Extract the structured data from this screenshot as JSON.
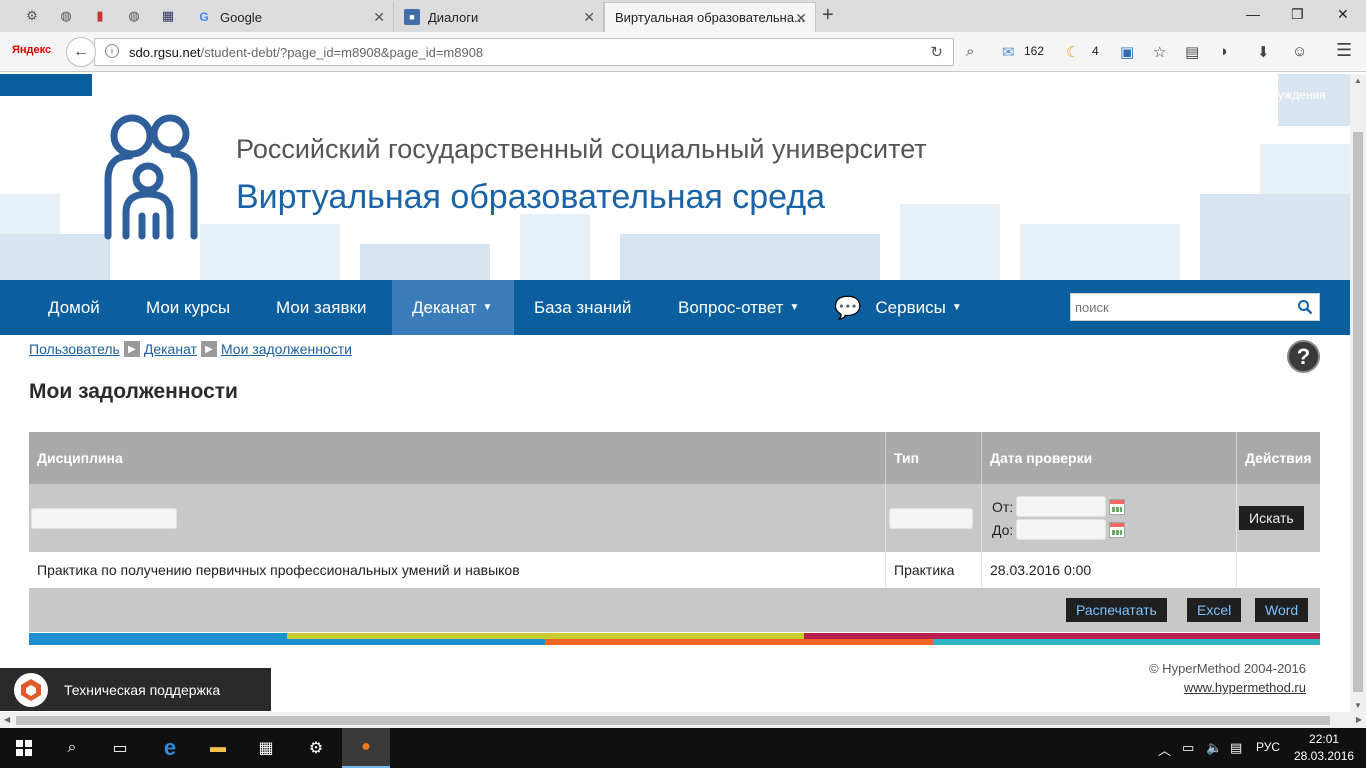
{
  "browser": {
    "tabs": [
      {
        "label": "Google"
      },
      {
        "label": "Диалоги"
      },
      {
        "label": "Виртуальная образовательна..."
      }
    ],
    "yandex_label": "Яндекс",
    "url_host": "sdo.rgsu.net",
    "url_path": "/student-debt/?page_id=m8908&page_id=m8908",
    "mail_count": "162",
    "weather_count": "4"
  },
  "header": {
    "university": "Российский государственный социальный университет",
    "subtitle": "Виртуальная образовательная среда",
    "right_link": "уждения"
  },
  "nav": {
    "items": [
      {
        "label": "Домой"
      },
      {
        "label": "Мои курсы"
      },
      {
        "label": "Мои заявки"
      },
      {
        "label": "Деканат"
      },
      {
        "label": "База знаний"
      },
      {
        "label": "Вопрос-ответ"
      },
      {
        "label": "Сервисы"
      }
    ],
    "search_placeholder": "поиск"
  },
  "breadcrumb": [
    "Пользователь",
    "Деканат",
    "Мои задолженности"
  ],
  "page_title": "Мои задолженности",
  "grid": {
    "columns": [
      "Дисциплина",
      "Тип",
      "Дата проверки",
      "Действия"
    ],
    "filter": {
      "from_label": "От:",
      "to_label": "До:",
      "search_button": "Искать"
    },
    "rows": [
      {
        "discipline": "Практика по получению первичных профессиональных умений и навыков",
        "type": "Практика",
        "date": "28.03.2016 0:00",
        "actions": ""
      }
    ],
    "footer_buttons": [
      "Распечатать",
      "Excel",
      "Word"
    ]
  },
  "footer": {
    "copyright": "© HyperMethod 2004-2016",
    "link": "www.hypermethod.ru"
  },
  "support": {
    "label": "Техническая поддержка"
  },
  "taskbar": {
    "lang": "РУС",
    "time": "22:01",
    "date": "28.03.2016"
  },
  "colors": {
    "nav_blue": "#0b5f9e",
    "nav_active": "#3b7dbb",
    "title_blue": "#1a63a6"
  }
}
